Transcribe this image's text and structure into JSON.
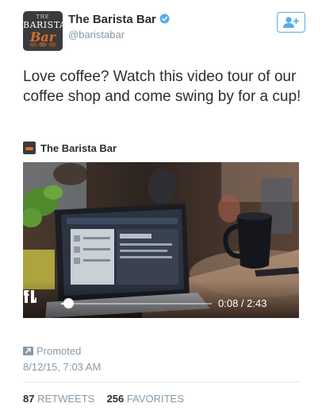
{
  "account": {
    "name": "The Barista Bar",
    "handle": "@baristabar",
    "verified": true,
    "avatar_text_top": "THE",
    "avatar_text_mid": "BARISTA",
    "avatar_text_script": "Bar"
  },
  "follow_button": {
    "icon": "add-user-icon"
  },
  "tweet": {
    "text": "Love coffee?  Watch this video tour of our coffee shop and come swing by for a cup!"
  },
  "card": {
    "source_name": "The Barista Bar",
    "video": {
      "time": "0:08 / 2:43",
      "progress": 0.049,
      "state": "playing"
    }
  },
  "meta": {
    "promoted_label": "Promoted",
    "timestamp": "8/12/15, 7:03 AM"
  },
  "stats": {
    "retweets_count": "87",
    "retweets_label": "RETWEETS",
    "favorites_count": "256",
    "favorites_label": "FAVORITES"
  },
  "colors": {
    "accent": "#55acee",
    "text": "#292f33",
    "muted": "#8899a6",
    "divider": "#e1e8ed"
  }
}
